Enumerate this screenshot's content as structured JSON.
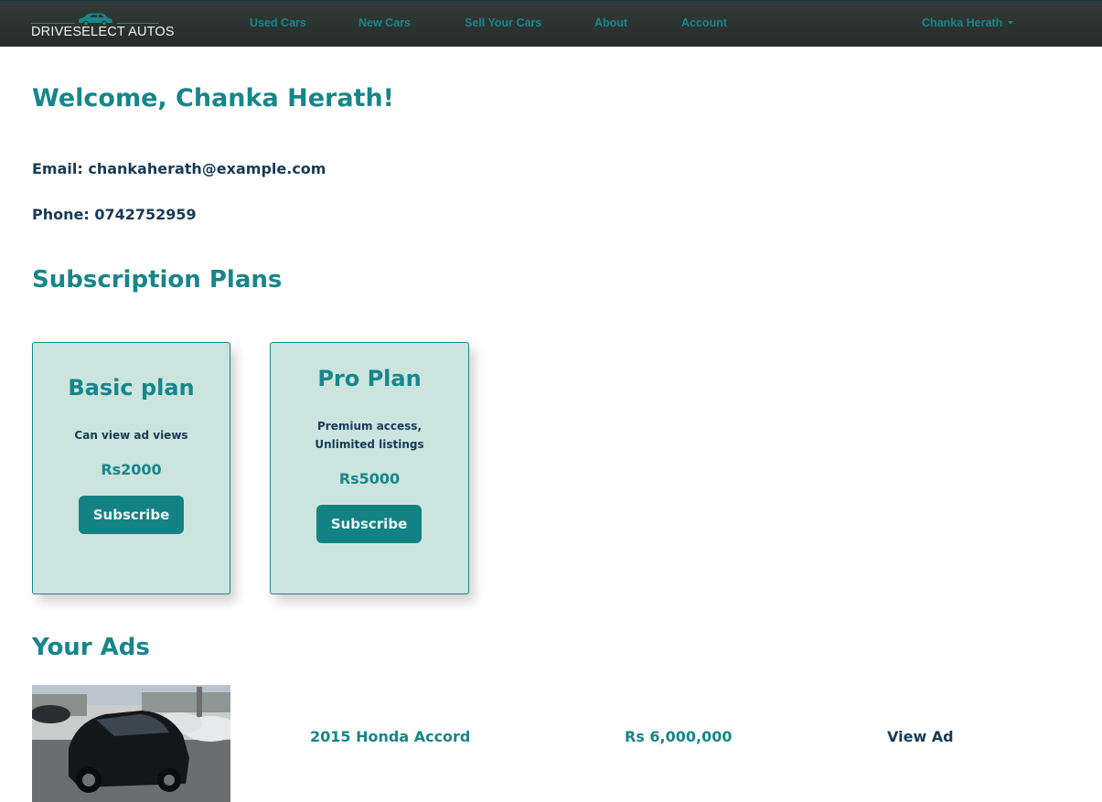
{
  "brand": {
    "name": "DRIVESELECT AUTOS",
    "icon": "car-icon"
  },
  "nav": {
    "items": [
      {
        "label": "Used Cars"
      },
      {
        "label": "New Cars"
      },
      {
        "label": "Sell Your Cars"
      },
      {
        "label": "About"
      },
      {
        "label": "Account"
      }
    ],
    "user": "Chanka Herath"
  },
  "profile": {
    "welcome": "Welcome, Chanka Herath!",
    "email": "Email: chankaherath@example.com",
    "phone": "Phone: 0742752959"
  },
  "subscriptions": {
    "heading": "Subscription Plans",
    "plans": [
      {
        "title": "Basic plan",
        "desc_lines": [
          "Can view ad views"
        ],
        "price": "Rs2000",
        "button": "Subscribe"
      },
      {
        "title": "Pro Plan",
        "desc_lines": [
          "Premium access,",
          "Unlimited listings"
        ],
        "price": "Rs5000",
        "button": "Subscribe"
      }
    ]
  },
  "ads": {
    "heading": "Your Ads",
    "items": [
      {
        "title": "2015 Honda Accord",
        "price": "Rs 6,000,000",
        "link": "View Ad"
      }
    ]
  },
  "colors": {
    "accent": "#16868a",
    "navy": "#173a56",
    "card_bg": "#cce4de",
    "nav_bg": "#2c3331"
  }
}
